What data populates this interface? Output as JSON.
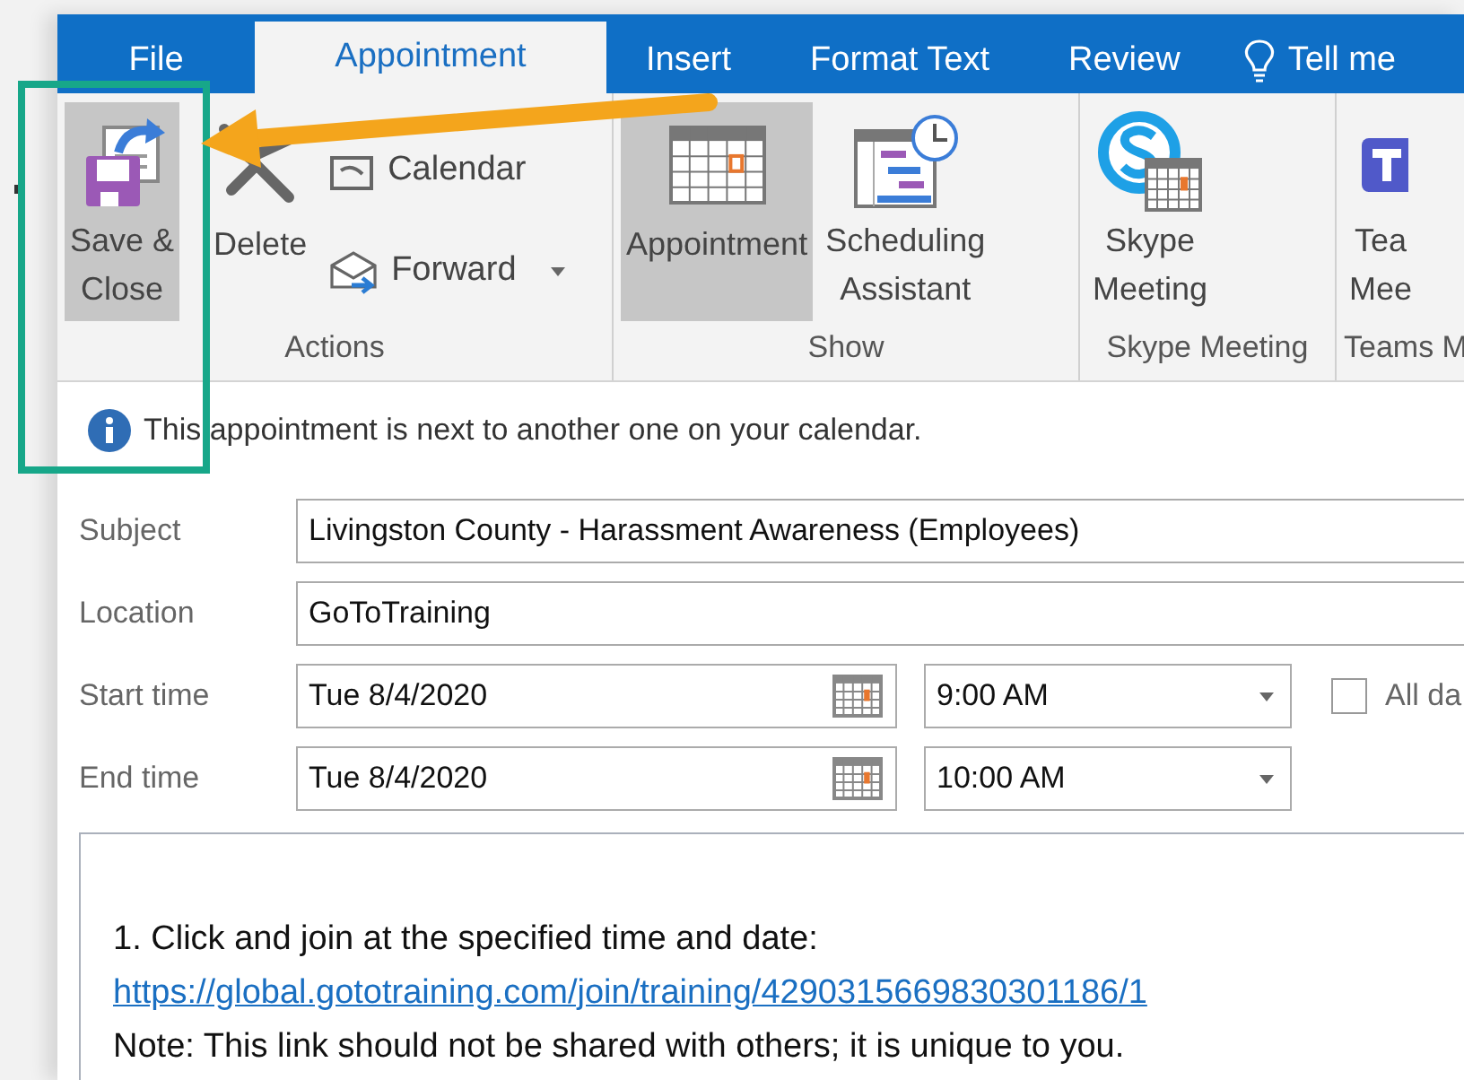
{
  "tabs": [
    {
      "label": "File",
      "selected": false
    },
    {
      "label": "Appointment",
      "selected": true
    },
    {
      "label": "Insert",
      "selected": false
    },
    {
      "label": "Format Text",
      "selected": false
    },
    {
      "label": "Review",
      "selected": false
    }
  ],
  "tell_me": "Tell me",
  "ribbon_groups": [
    {
      "label": "Actions",
      "buttons": [
        {
          "kind": "large",
          "label": "Save &\nClose",
          "highlighted": true
        },
        {
          "kind": "large",
          "label": "Delete",
          "highlighted": false
        },
        {
          "kind": "small",
          "label": "Calendar",
          "dropdown": false
        },
        {
          "kind": "small",
          "label": "Forward",
          "dropdown": true
        }
      ]
    },
    {
      "label": "Show",
      "buttons": [
        {
          "kind": "large",
          "label": "Appointment",
          "highlighted": true
        },
        {
          "kind": "large",
          "label": "Scheduling\nAssistant",
          "highlighted": false
        }
      ]
    },
    {
      "label": "Skype Meeting",
      "buttons": [
        {
          "kind": "large",
          "label": "Skype\nMeeting",
          "highlighted": false
        }
      ]
    },
    {
      "label": "Teams M",
      "buttons": [
        {
          "kind": "large",
          "label": "Tea\nMee",
          "highlighted": false
        }
      ]
    }
  ],
  "info_bar": "This appointment is next to another one on your calendar.",
  "fields": [
    {
      "kind": "text",
      "label": "Subject",
      "value": "Livingston County - Harassment Awareness (Employees)"
    },
    {
      "kind": "text",
      "label": "Location",
      "value": "GoToTraining"
    },
    {
      "kind": "datetime",
      "label": "Start time",
      "date": "Tue 8/4/2020",
      "time": "9:00 AM",
      "all_day": {
        "label": "All da",
        "checked": false
      }
    },
    {
      "kind": "datetime",
      "label": "End time",
      "date": "Tue 8/4/2020",
      "time": "10:00 AM"
    }
  ],
  "body": [
    {
      "kind": "text",
      "text": "1. Click and join at the specified time and date:"
    },
    {
      "kind": "link",
      "text": "https://global.gototraining.com/join/training/4290315669830301186/1"
    },
    {
      "kind": "text",
      "text": "Note: This link should not be shared with others; it is unique to you."
    }
  ],
  "annotations": [
    {
      "kind": "box"
    },
    {
      "kind": "arrow"
    }
  ]
}
